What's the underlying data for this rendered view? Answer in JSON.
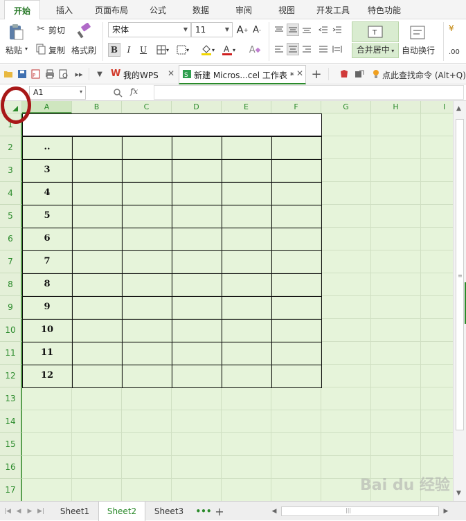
{
  "menu": {
    "tabs": [
      "开始",
      "插入",
      "页面布局",
      "公式",
      "数据",
      "审阅",
      "视图",
      "开发工具",
      "特色功能"
    ],
    "active_index": 0
  },
  "ribbon": {
    "paste_label": "粘贴",
    "cut_label": "剪切",
    "copy_label": "复制",
    "format_painter_label": "格式刷",
    "font_name": "宋体",
    "font_size": "11",
    "bold": "B",
    "italic": "I",
    "underline": "U",
    "merge_center_label": "合并居中",
    "wrap_text_label": "自动换行",
    "number_format_glyphs": "¥",
    "decimal_glyph": ".00"
  },
  "doc_tabs": {
    "wps_label": "我的WPS",
    "workbook_label": "新建 Micros...cel 工作表 *",
    "search_command_label": "点此查找命令 (Alt+Q)"
  },
  "formula_bar": {
    "name_box": "A1",
    "fx_label": "fx",
    "formula_value": ""
  },
  "grid": {
    "columns": [
      "A",
      "B",
      "C",
      "D",
      "E",
      "F",
      "G",
      "H",
      "I"
    ],
    "rows": [
      "1",
      "2",
      "3",
      "4",
      "5",
      "6",
      "7",
      "8",
      "9",
      "10",
      "11",
      "12",
      "13",
      "14",
      "15",
      "16",
      "17"
    ],
    "column_a_values": [
      "",
      "..",
      "3",
      "4",
      "5",
      "6",
      "7",
      "8",
      "9",
      "10",
      "11",
      "12",
      "",
      "",
      "",
      "",
      ""
    ]
  },
  "sheets": {
    "tabs": [
      "Sheet1",
      "Sheet2",
      "Sheet3"
    ],
    "active_index": 1
  },
  "watermark": "Bai du 经验",
  "colors": {
    "accent_green": "#2a8a2a",
    "grid_bg": "#e6f4da",
    "annotation_red": "#a81818"
  }
}
